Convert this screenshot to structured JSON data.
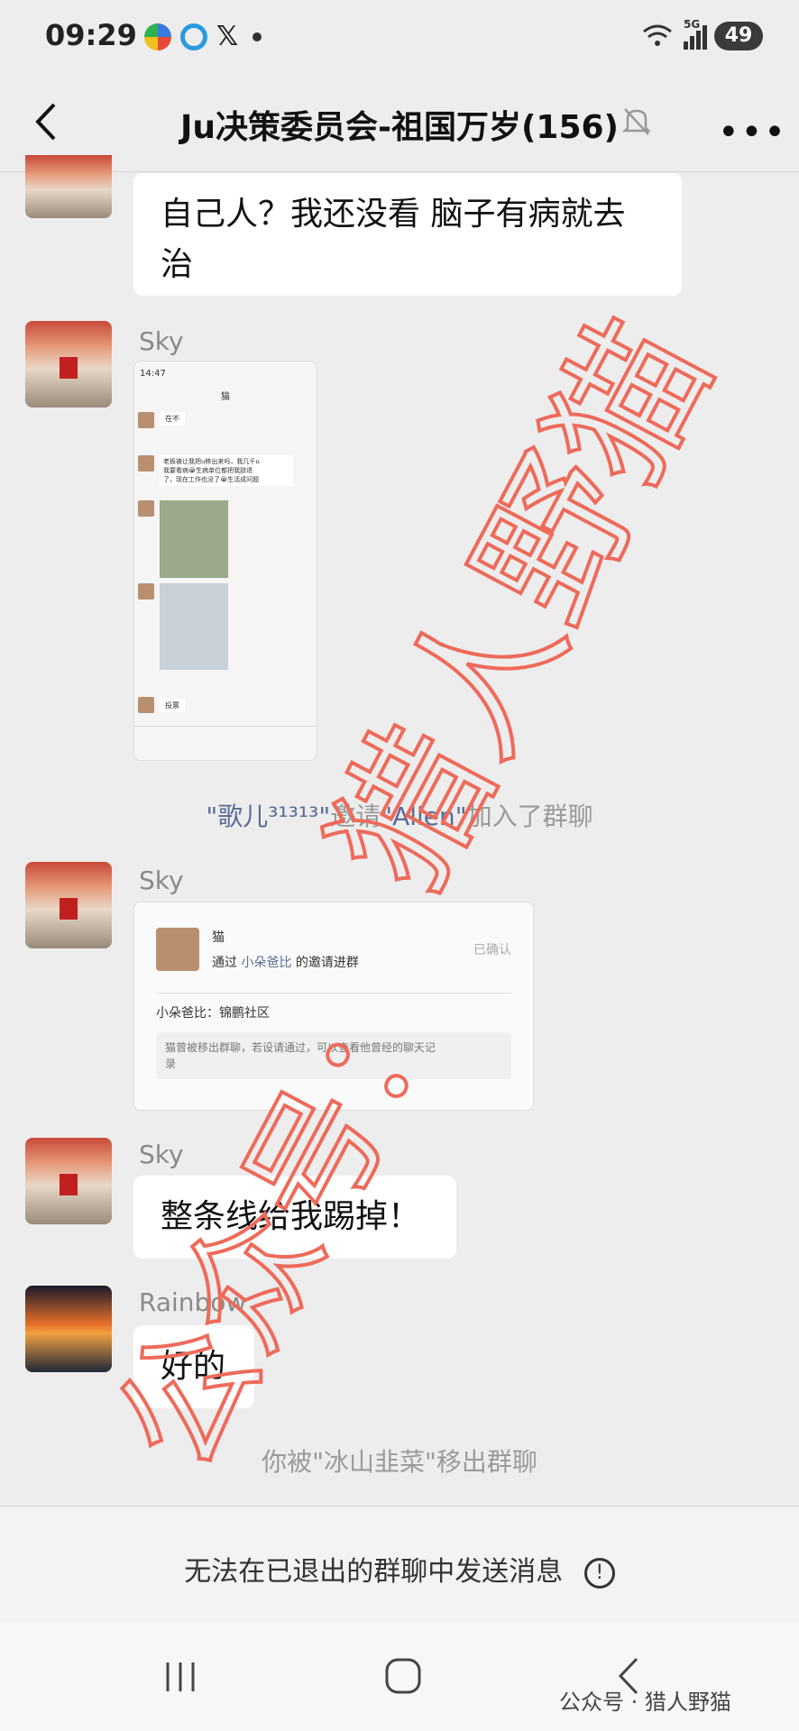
{
  "status_bar": {
    "time": "09:29",
    "battery": "49",
    "signal_label": "5G"
  },
  "header": {
    "title": "Ju决策委员会-祖国万岁(156)"
  },
  "messages": [
    {
      "text": "自己人？我还没看 脑子有病就去治"
    },
    {
      "sender": "Sky",
      "screenshot": {
        "time": "14:47",
        "chat_title": "猫",
        "lines": [
          "在不",
          "老板被让我把u移出来吗，我几千u\n我要看病😭生病单位都把我辞退\n了，现在工作也没了😭生活成问题",
          "投票"
        ]
      }
    },
    {
      "sys_prefix": "\"歌儿³¹³¹³\"",
      "sys_mid": "邀请",
      "sys_name": "\"Allen\"",
      "sys_suffix": "加入了群聊"
    },
    {
      "sender": "Sky",
      "card": {
        "name": "猫",
        "status": "已确认",
        "line1_pre": "通过",
        "line1_name": "小朵爸比",
        "line1_post": "的邀请进群",
        "line2": "小朵爸比：锦鹏社区",
        "note": "猫曾被移出群聊，若设请通过，可以查看他曾经的聊天记录"
      }
    },
    {
      "sender": "Sky",
      "text": "整条线给我踢掉！"
    },
    {
      "sender": "Rainbow",
      "text": "好的"
    },
    {
      "sys": "你被\"冰山韭菜\"移出群聊"
    }
  ],
  "notice": "无法在已退出的群聊中发送消息",
  "footer_watermark": "公众号 · 猎人野猫",
  "watermark": {
    "line1": "公众号：",
    "line2": "猎人野猫",
    "color": "#ee6a5a"
  }
}
